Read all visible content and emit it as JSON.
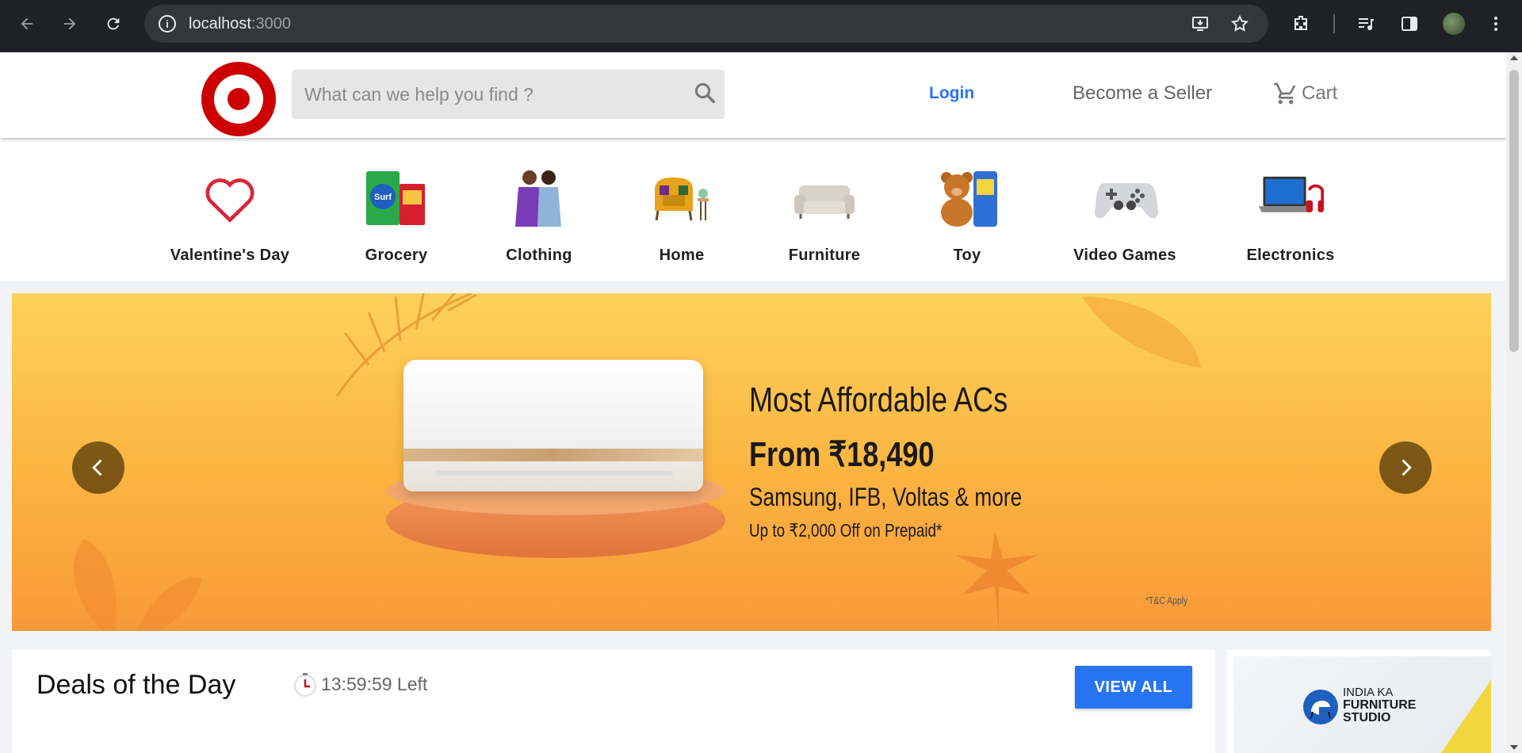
{
  "browser": {
    "url_host": "localhost",
    "url_port": ":3000"
  },
  "header": {
    "search_placeholder": "What can we help you find ?",
    "login_label": "Login",
    "seller_label": "Become a Seller",
    "cart_label": "Cart"
  },
  "categories": [
    {
      "label": "Valentine's Day",
      "icon": "heart-icon"
    },
    {
      "label": "Grocery",
      "icon": "grocery-image"
    },
    {
      "label": "Clothing",
      "icon": "clothing-image"
    },
    {
      "label": "Home",
      "icon": "home-image"
    },
    {
      "label": "Furniture",
      "icon": "furniture-image"
    },
    {
      "label": "Toy",
      "icon": "toy-image"
    },
    {
      "label": "Video Games",
      "icon": "gamepad-image"
    },
    {
      "label": "Electronics",
      "icon": "laptop-image"
    }
  ],
  "banner": {
    "line1": "Most Affordable ACs",
    "line2": "From ₹18,490",
    "line3": "Samsung, IFB, Voltas & more",
    "line4": "Up to ₹2,000 Off on Prepaid*",
    "tnc": "*T&C Apply"
  },
  "deals": {
    "title": "Deals of the Day",
    "timer": "13:59:59 Left",
    "view_all_label": "VIEW ALL"
  },
  "side_ad": {
    "line1": "INDIA KA",
    "line2": "FURNITURE",
    "line3": "STUDIO"
  },
  "colors": {
    "brand": "#cc0000",
    "accent": "#2874f0"
  }
}
